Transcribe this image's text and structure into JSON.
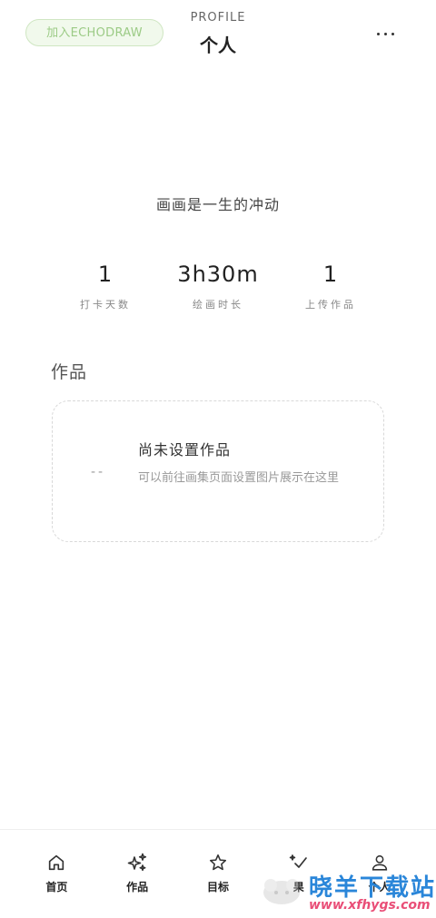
{
  "header": {
    "join_label": "加入ECHODRAW",
    "subtitle": "PROFILE",
    "title": "个人",
    "more_icon": "more-horizontal-icon"
  },
  "profile": {
    "motto": "画画是一生的冲动",
    "stats": [
      {
        "value": "1",
        "label": "打卡天数"
      },
      {
        "value": "3h30m",
        "label": "绘画时长"
      },
      {
        "value": "1",
        "label": "上传作品"
      }
    ]
  },
  "works": {
    "section_title": "作品",
    "empty": {
      "dash": "--",
      "title": "尚未设置作品",
      "description": "可以前往画集页面设置图片展示在这里"
    }
  },
  "bottom_nav": {
    "items": [
      {
        "label": "首页",
        "icon": "home-icon"
      },
      {
        "label": "作品",
        "icon": "sparkles-icon"
      },
      {
        "label": "目标",
        "icon": "star-icon"
      },
      {
        "label": "果",
        "icon": "check-sparkle-icon"
      },
      {
        "label": "个人",
        "icon": "user-icon"
      }
    ]
  },
  "watermark": {
    "text": "晓羊下载站",
    "url": "www.xfhygs.com"
  },
  "colors": {
    "join_bg": "#f1f9ec",
    "join_border": "#cfe6c2",
    "join_text": "#9ccb86",
    "card_border": "#d8d8d8",
    "watermark_blue": "#2a86d9",
    "watermark_pink": "#e94e77",
    "watermark_orange": "#f39c12"
  }
}
